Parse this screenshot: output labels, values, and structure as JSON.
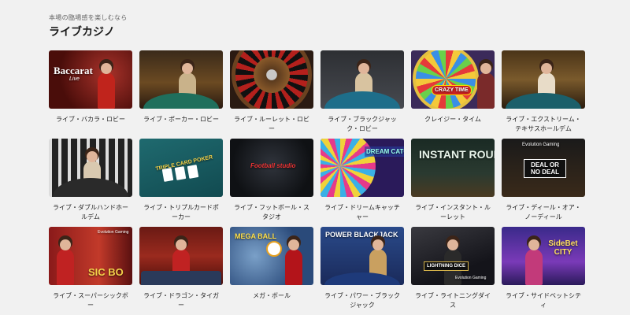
{
  "header": {
    "subtitle": "本場の臨場感を楽しむなら",
    "title": "ライブカジノ"
  },
  "games": [
    {
      "label": "ライブ・バカラ・ロビー",
      "overlay": "Baccarat"
    },
    {
      "label": "ライブ・ポーカー・ロビー",
      "overlay": ""
    },
    {
      "label": "ライブ・ルーレット・ロビー",
      "overlay": ""
    },
    {
      "label": "ライブ・ブラックジャック・ロビー",
      "overlay": ""
    },
    {
      "label": "クレイジー・タイム",
      "overlay": "CRAZY TIME"
    },
    {
      "label": "ライブ・エクストリーム・テキサスホールデム",
      "overlay": ""
    },
    {
      "label": "ライブ・ダブルハンドホールデム",
      "overlay": ""
    },
    {
      "label": "ライブ・トリプルカードポーカー",
      "overlay": "TRIPLE CARD POKER"
    },
    {
      "label": "ライブ・フットボール・スタジオ",
      "overlay": "Football studio"
    },
    {
      "label": "ライブ・ドリームキャッチャー",
      "overlay": "DREAM CATCHER"
    },
    {
      "label": "ライブ・インスタント・ルーレット",
      "overlay": "INSTANT ROULETTE"
    },
    {
      "label": "ライブ・ディール・オア・ノーディール",
      "overlay": "DEAL OR NO DEAL"
    },
    {
      "label": "ライブ・スーパーシックボー",
      "overlay": "SIC BO"
    },
    {
      "label": "ライブ・ドラゴン・タイガー",
      "overlay": ""
    },
    {
      "label": "メガ・ボール",
      "overlay": "MEGA BALL"
    },
    {
      "label": "ライブ・パワー・ブラックジャック",
      "overlay": "POWER BLACKJACK"
    },
    {
      "label": "ライブ・ライトニングダイス",
      "overlay": "LIGHTNING DICE"
    },
    {
      "label": "ライブ・サイドベットシティ",
      "overlay": "SideBet CITY"
    }
  ],
  "overlay_extras": {
    "live": "Live",
    "evolution": "Evolution Gaming"
  },
  "colors": {
    "background": "#f1f1f1",
    "text": "#222222"
  }
}
